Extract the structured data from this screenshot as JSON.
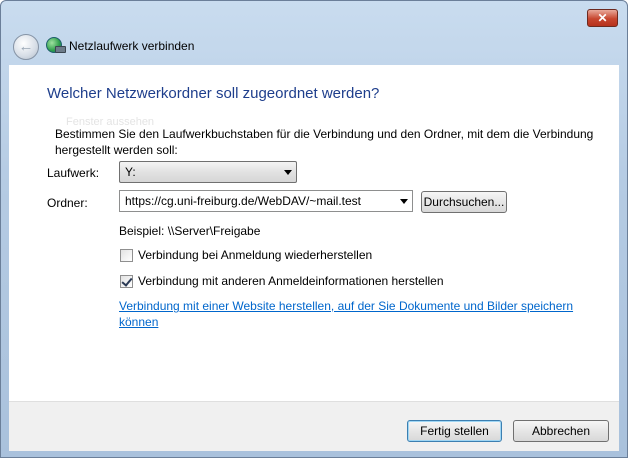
{
  "window": {
    "close_label": "✕"
  },
  "header": {
    "title": "Netzlaufwerk verbinden",
    "back_glyph": "←"
  },
  "main": {
    "heading": "Welcher Netzwerkordner soll zugeordnet werden?",
    "ghost_text": "Fenster aussehen",
    "description": "Bestimmen Sie den Laufwerkbuchstaben für die Verbindung und den Ordner, mit dem die Verbindung hergestellt werden soll:",
    "drive_label": "Laufwerk:",
    "drive_value": "Y:",
    "folder_label": "Ordner:",
    "folder_value": "https://cg.uni-freiburg.de/WebDAV/~mail.test",
    "browse_label": "Durchsuchen...",
    "example": "Beispiel: \\\\Server\\Freigabe",
    "reconnect_label": "Verbindung bei Anmeldung wiederherstellen",
    "reconnect_checked": false,
    "other_creds_label": "Verbindung mit anderen Anmeldeinformationen herstellen",
    "other_creds_checked": true,
    "website_link": "Verbindung mit einer Website herstellen, auf der Sie Dokumente und Bilder speichern können"
  },
  "footer": {
    "finish_label": "Fertig stellen",
    "cancel_label": "Abbrechen"
  },
  "colors": {
    "heading": "#1e3e8c",
    "link": "#0066cc",
    "close": "#c7462f"
  }
}
